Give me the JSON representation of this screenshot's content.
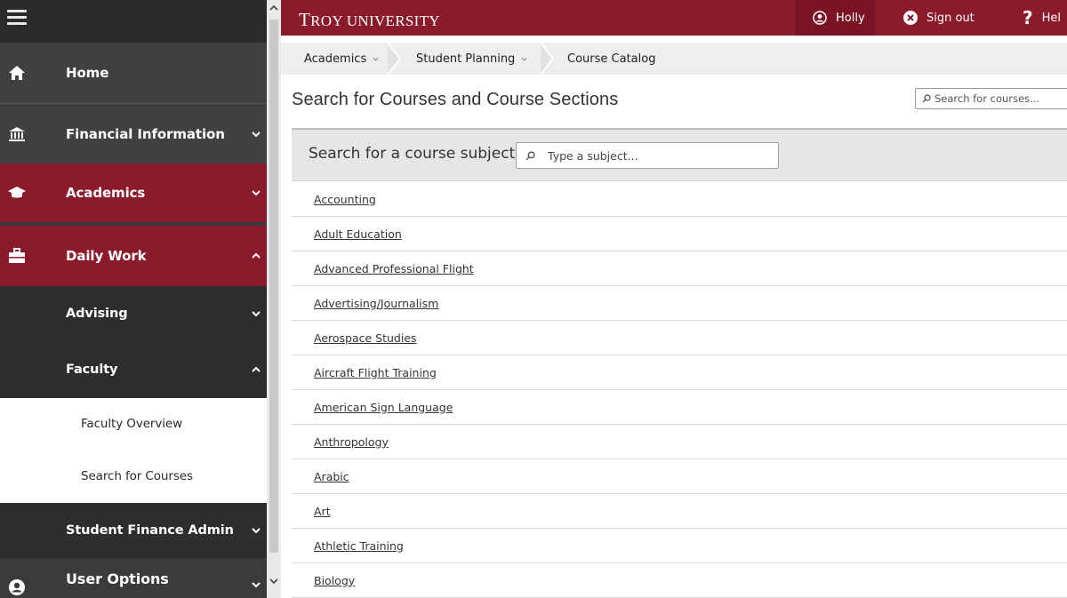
{
  "topbar": {
    "brand": "Troy University",
    "brand_first": "T",
    "brand_rest": "ROY UNIVERSITY",
    "user": "Holly",
    "signout": "Sign out",
    "help": "Hel",
    "color": "#8b1a2b"
  },
  "sidebar": {
    "items": [
      {
        "label": "Home",
        "icon": "home-icon"
      },
      {
        "label": "Financial Information",
        "icon": "bank-icon"
      },
      {
        "label": "Academics",
        "icon": "graduation-cap-icon"
      },
      {
        "label": "Daily Work",
        "icon": "briefcase-icon"
      },
      {
        "label": "Advising"
      },
      {
        "label": "Faculty"
      },
      {
        "label": "Faculty Overview"
      },
      {
        "label": "Search for Courses"
      },
      {
        "label": "Student Finance Admin"
      },
      {
        "label": "User Options",
        "icon": "user-circle-icon"
      }
    ]
  },
  "breadcrumb": {
    "items": [
      "Academics",
      "Student Planning",
      "Course Catalog"
    ]
  },
  "main": {
    "title": "Search for Courses and Course Sections",
    "search_placeholder": "Search for courses...",
    "subject_label": "Search for a course subject:",
    "subject_placeholder": "Type a subject...",
    "subjects": [
      "Accounting",
      "Adult Education",
      "Advanced Professional Flight",
      "Advertising/Journalism",
      "Aerospace Studies",
      "Aircraft Flight Training",
      "American Sign Language",
      "Anthropology",
      "Arabic",
      "Art",
      "Athletic Training",
      "Biology"
    ]
  }
}
